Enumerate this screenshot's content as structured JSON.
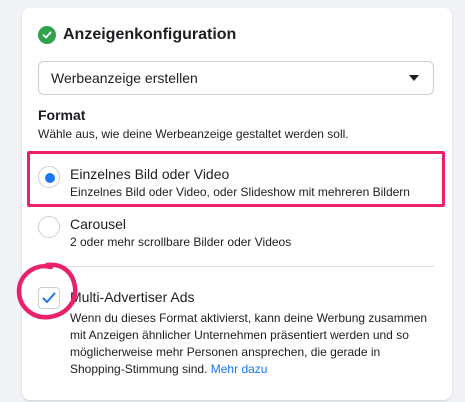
{
  "header": {
    "title": "Anzeigenkonfiguration",
    "status_icon": "check-circle-icon",
    "status_color": "#31a24c"
  },
  "creation_select": {
    "value": "Werbeanzeige erstellen"
  },
  "format": {
    "label": "Format",
    "help": "Wähle aus, wie deine Werbeanzeige gestaltet werden soll.",
    "options": [
      {
        "title": "Einzelnes Bild oder Video",
        "description": "Einzelnes Bild oder Video, oder Slideshow mit mehreren Bildern",
        "selected": true
      },
      {
        "title": "Carousel",
        "description": "2 oder mehr scrollbare Bilder oder Videos",
        "selected": false
      }
    ]
  },
  "multi_advertiser": {
    "title": "Multi-Advertiser Ads",
    "checked": true,
    "description": "Wenn du dieses Format aktivierst, kann deine Werbung zusammen mit Anzeigen ähnlicher Unternehmen präsentiert werden und so möglicherweise mehr Personen ansprechen, die gerade in Shopping-Stimmung sind.",
    "learn_more": "Mehr dazu"
  },
  "colors": {
    "accent": "#1877f2",
    "highlight": "#e8216a"
  }
}
